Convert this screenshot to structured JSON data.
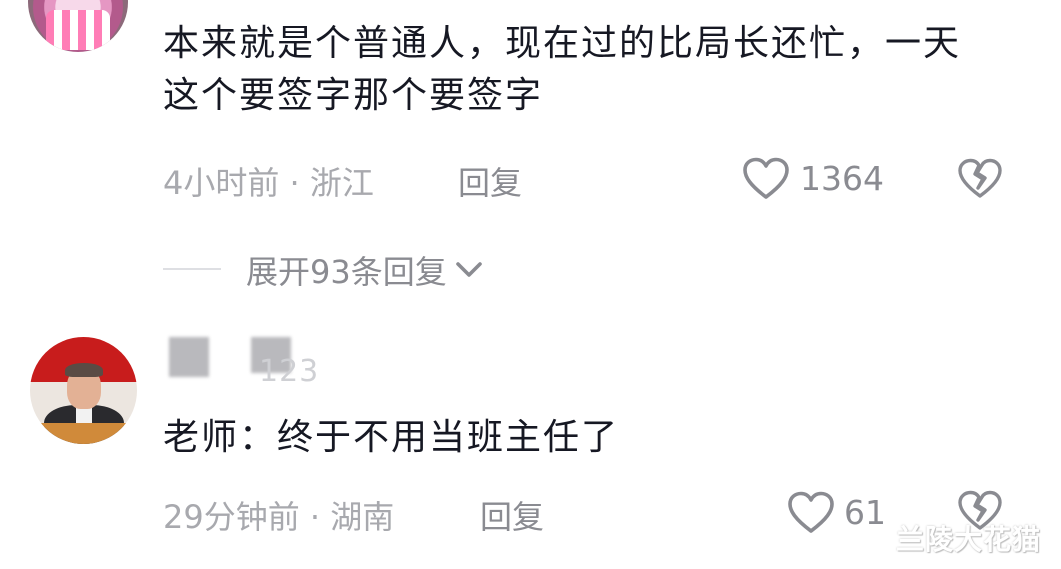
{
  "comments": [
    {
      "text": "本来就是个普通人，现在过的比局长还忙，一天这个要签字那个要签字",
      "time": "4小时前",
      "separator": " · ",
      "location": "浙江",
      "reply_label": "回复",
      "likes": "1364",
      "expand_replies": "展开93条回复"
    },
    {
      "username_fragment": "123",
      "text": "老师：终于不用当班主任了",
      "time": "29分钟前",
      "separator": " · ",
      "location": "湖南",
      "reply_label": "回复",
      "likes": "61"
    }
  ],
  "watermark": "兰陵大花猫",
  "icons": {
    "like": "heart-outline-icon",
    "dislike": "broken-heart-icon",
    "expand": "chevron-down-icon"
  },
  "colors": {
    "text": "#161823",
    "meta": "#a8a9ae",
    "secondary": "#8a8b91"
  }
}
